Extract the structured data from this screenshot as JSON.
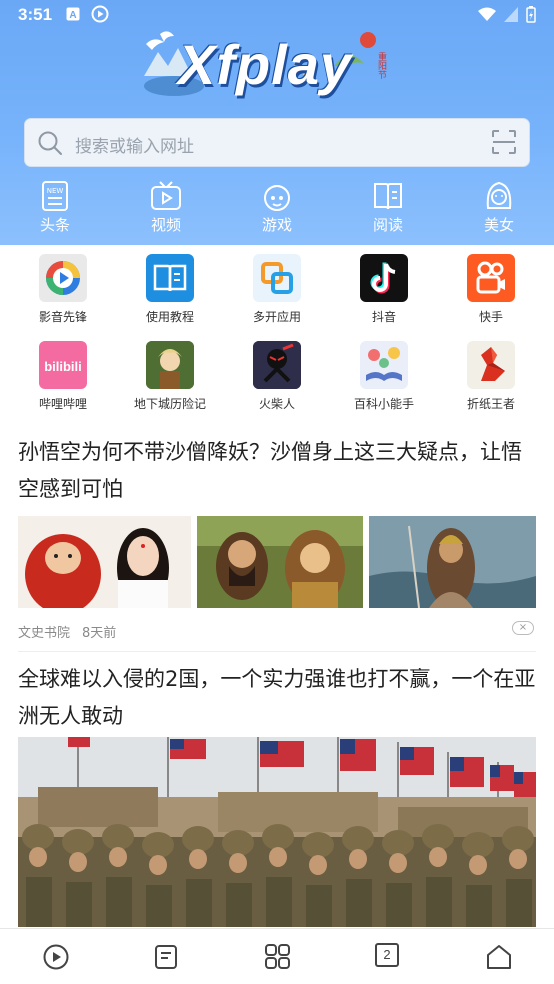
{
  "status_bar": {
    "time": "3:51"
  },
  "header": {
    "logo_text": "Xfplay",
    "logo_sub": "重阳节",
    "search": {
      "placeholder": "搜索或输入网址"
    },
    "quick_nav": [
      {
        "label": "头条",
        "icon": "news-icon"
      },
      {
        "label": "视频",
        "icon": "tv-icon"
      },
      {
        "label": "游戏",
        "icon": "game-icon"
      },
      {
        "label": "阅读",
        "icon": "book-icon"
      },
      {
        "label": "美女",
        "icon": "girl-icon"
      }
    ]
  },
  "apps": [
    {
      "label": "影音先锋",
      "color": "#e9e9e9"
    },
    {
      "label": "使用教程",
      "color": "#1e8fe0"
    },
    {
      "label": "多开应用",
      "color": "#e8f3fc"
    },
    {
      "label": "抖音",
      "color": "#111111"
    },
    {
      "label": "快手",
      "color": "#fe5b23"
    },
    {
      "label": "哔哩哔哩",
      "color": "#f46ba2"
    },
    {
      "label": "地下城历险记",
      "color": "#5a7a3a"
    },
    {
      "label": "火柴人",
      "color": "#2a2a40"
    },
    {
      "label": "百科小能手",
      "color": "#eaeef8"
    },
    {
      "label": "折纸王者",
      "color": "#f2efe6"
    }
  ],
  "feed": [
    {
      "title": "孙悟空为何不带沙僧降妖？沙僧身上这三大疑点，让悟空感到可怕",
      "source": "文史书院",
      "time": "8天前",
      "close_symbol": "×"
    },
    {
      "title": "全球难以入侵的2国，一个实力强谁也打不赢，一个在亚洲无人敢动"
    }
  ],
  "bottom_nav": {
    "tab_count": "2"
  },
  "colors": {
    "header_top": "#6aa8f6",
    "header_bottom": "#8cc0fd",
    "text_main": "#222222",
    "meta_text": "#8a8a8a"
  }
}
